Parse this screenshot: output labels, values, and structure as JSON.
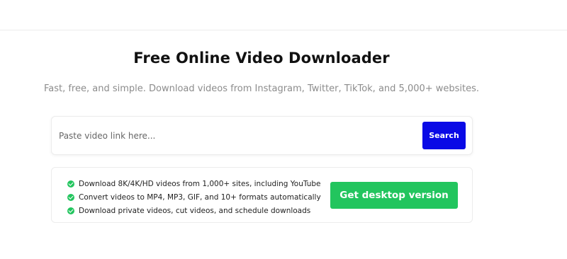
{
  "hero": {
    "title": "Free Online Video Downloader",
    "subtitle": "Fast, free, and simple. Download videos from Instagram, Twitter, TikTok, and 5,000+ websites."
  },
  "search": {
    "placeholder": "Paste video link here...",
    "value": "",
    "button_label": "Search",
    "button_color": "#0a0ae6"
  },
  "features": {
    "items": [
      "Download 8K/4K/HD videos from 1,000+ sites, including YouTube",
      "Convert videos to MP4, MP3, GIF, and 10+ formats automatically",
      "Download private videos, cut videos, and schedule downloads"
    ],
    "icon": "check-circle-icon",
    "icon_color": "#22c55e",
    "cta_label": "Get desktop version",
    "cta_color": "#22c55e"
  }
}
